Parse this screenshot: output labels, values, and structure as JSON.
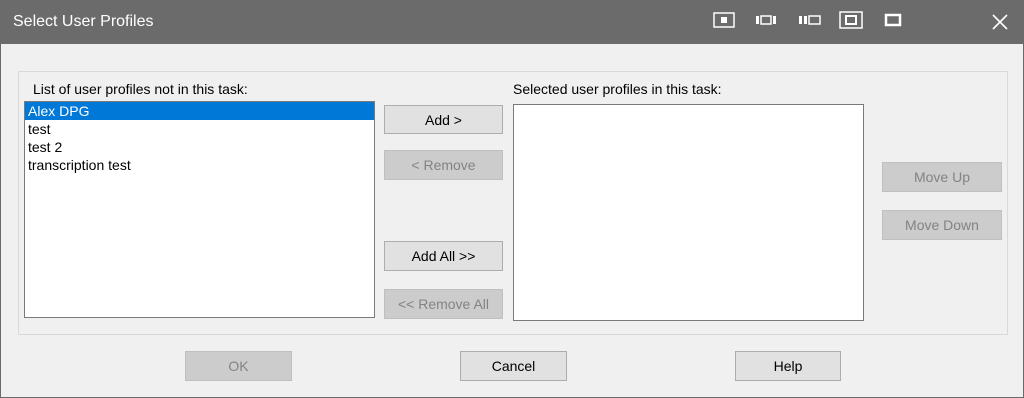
{
  "window": {
    "title": "Select User Profiles",
    "titlebar_icons": [
      "window-mode-icon",
      "window-dock-right-icon",
      "window-dock-left-icon",
      "window-center-icon",
      "window-maximize-icon",
      "close-icon"
    ]
  },
  "available": {
    "label": "List of user profiles not in this task:",
    "items": [
      "Alex DPG",
      "test",
      "test 2",
      "transcription test"
    ],
    "selected_index": 0
  },
  "selected": {
    "label": "Selected user profiles in this task:",
    "items": []
  },
  "buttons": {
    "add": "Add >",
    "remove": "< Remove",
    "add_all": "Add All >>",
    "remove_all": "<< Remove All",
    "move_up": "Move Up",
    "move_down": "Move Down",
    "ok": "OK",
    "cancel": "Cancel",
    "help": "Help"
  },
  "colors": {
    "titlebar": "#6b6b6b",
    "selection": "#0078d7"
  }
}
